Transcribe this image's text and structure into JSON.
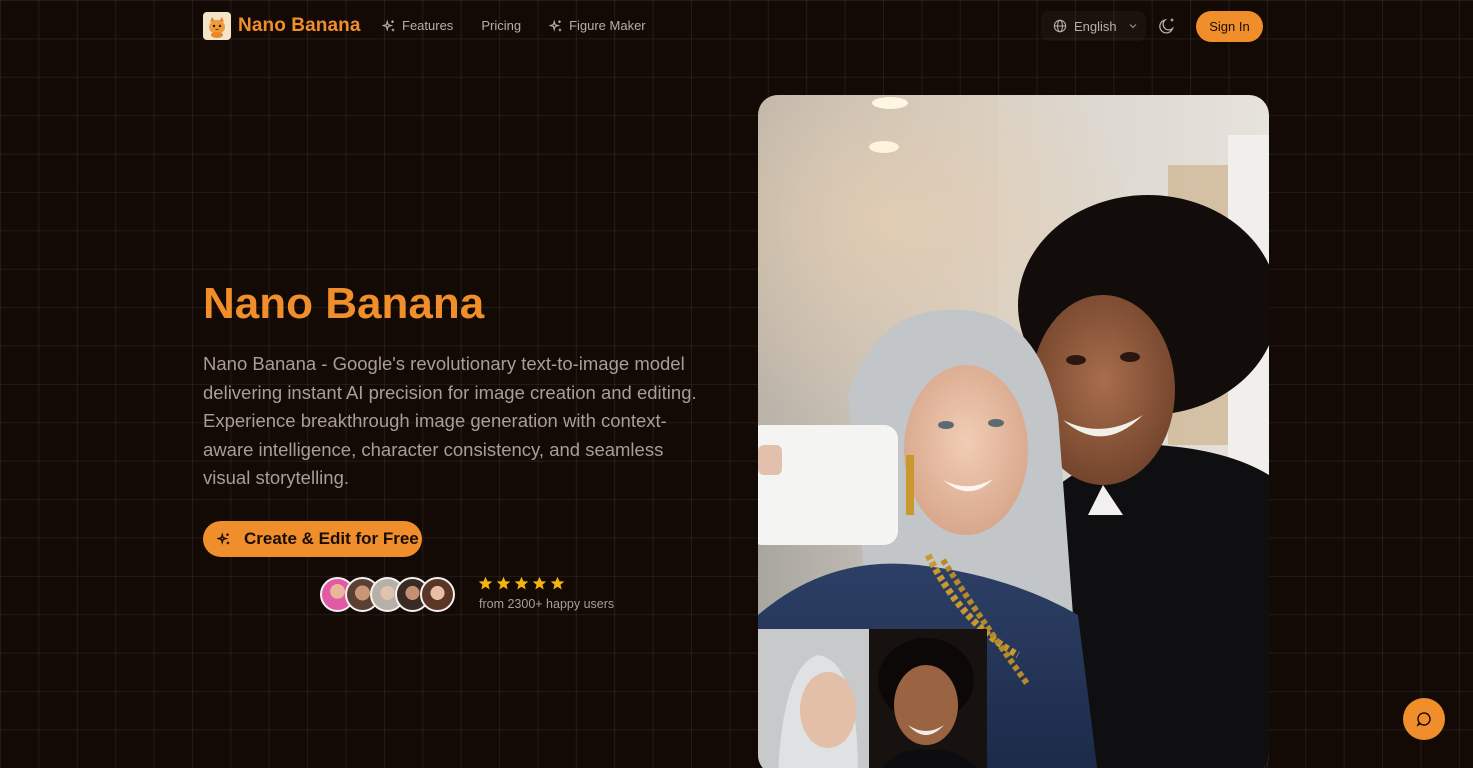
{
  "header": {
    "brand": "Nano Banana",
    "nav": [
      {
        "label": "Features",
        "icon": "sparkles-icon"
      },
      {
        "label": "Pricing",
        "icon": ""
      },
      {
        "label": "Figure Maker",
        "icon": "sparkles-icon"
      }
    ],
    "language": "English",
    "sign_in": "Sign In"
  },
  "hero": {
    "title": "Nano Banana",
    "description": "Nano Banana - Google's revolutionary text-to-image model delivering instant AI precision for image creation and editing. Experience breakthrough image generation with context-aware intelligence, character consistency, and seamless visual storytelling.",
    "cta": "Create & Edit for Free",
    "rating_text": "from 2300+ happy users",
    "star_count": 5
  },
  "colors": {
    "accent": "#f08e2b",
    "background": "#130a06",
    "star": "#f5b30f"
  }
}
